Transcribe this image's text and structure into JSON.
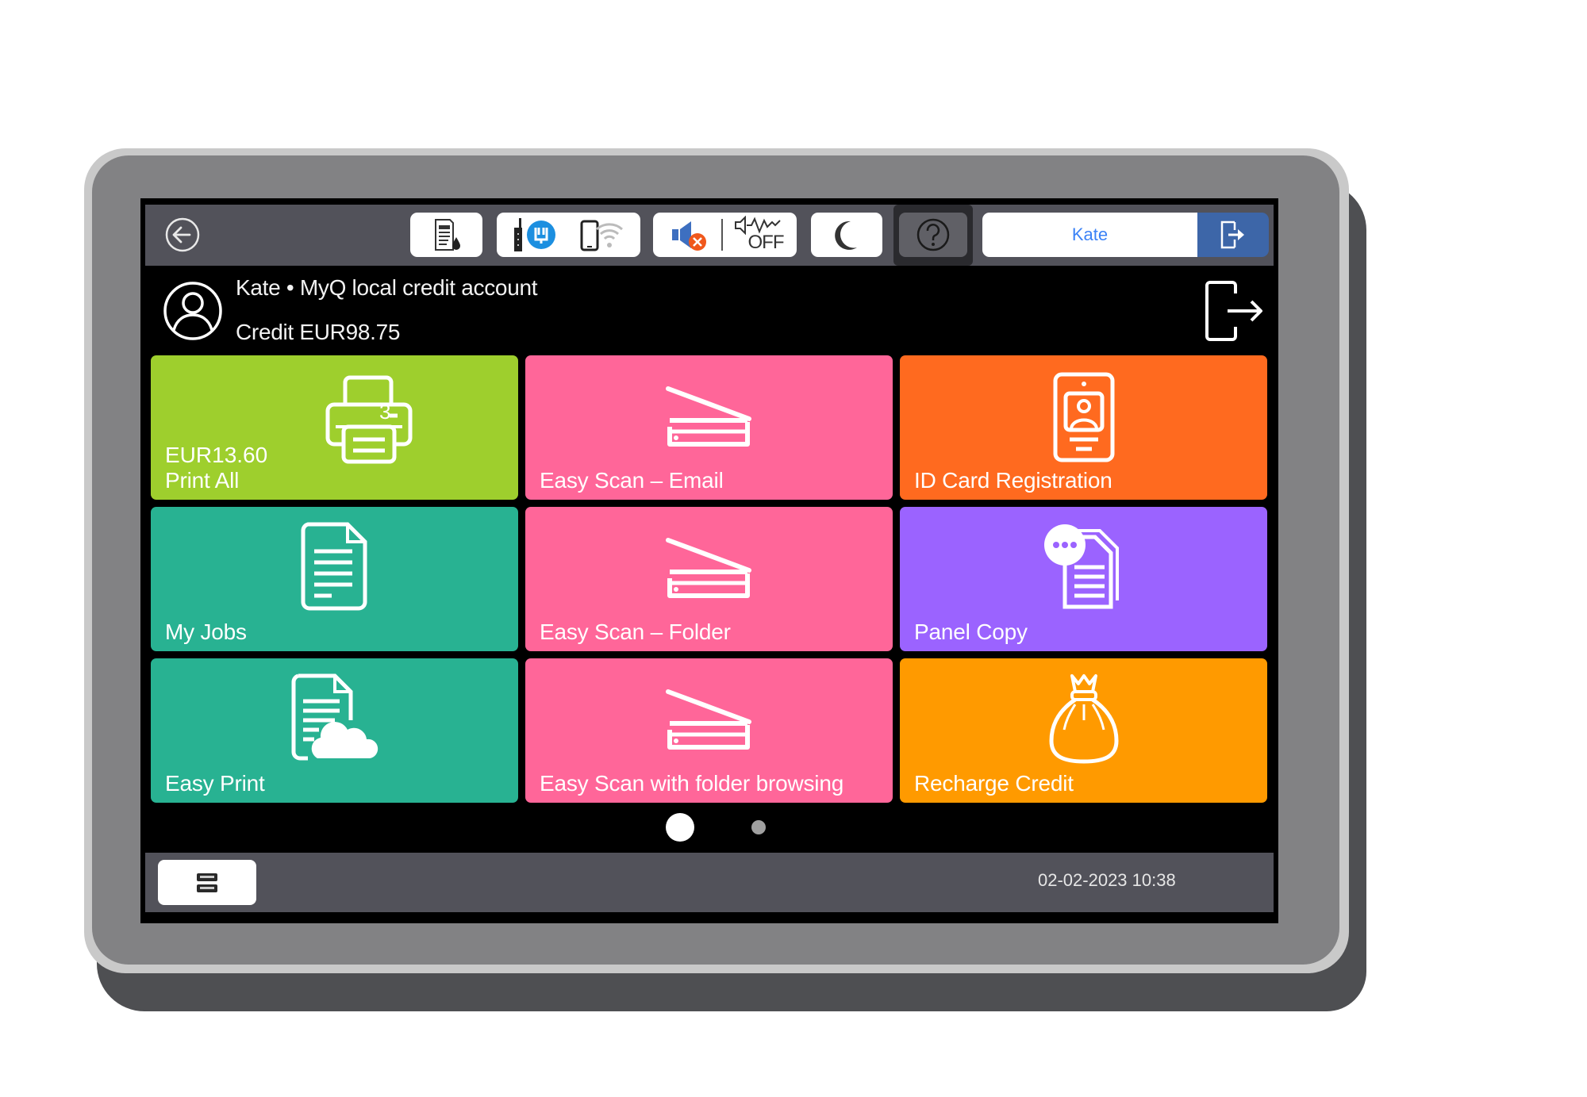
{
  "topbar": {
    "back_icon": "arrow-left-circle-icon",
    "status_buttons": [
      {
        "name": "toner-status",
        "icons": [
          "printer-toner-icon"
        ]
      },
      {
        "name": "network-status",
        "icons": [
          "ethernet-icon",
          "wifi-direct-icon"
        ]
      },
      {
        "name": "sound-status",
        "icons": [
          "speaker-muted-icon",
          "alarm-off-icon"
        ],
        "alarm_text": "OFF"
      },
      {
        "name": "sleep",
        "icons": [
          "moon-icon"
        ]
      },
      {
        "name": "help",
        "icons": [
          "question-circle-icon"
        ]
      }
    ],
    "user_name": "Kate",
    "logout_icon": "logout-icon"
  },
  "header": {
    "account_line": "Kate • MyQ local credit account",
    "credit_line": "Credit EUR98.75",
    "avatar_icon": "user-circle-icon",
    "logout_icon": "logout-icon"
  },
  "tiles": [
    {
      "label": "Print All",
      "amount": "EUR13.60",
      "badge": "3",
      "icon": "printer-icon",
      "color": "#9ecf2d"
    },
    {
      "label": "Easy Scan – Email",
      "icon": "scanner-icon",
      "color": "#ff6699"
    },
    {
      "label": "ID Card Registration",
      "icon": "id-card-icon",
      "color": "#ff6a1f"
    },
    {
      "label": "My Jobs",
      "icon": "document-icon",
      "color": "#28b292"
    },
    {
      "label": "Easy Scan – Folder",
      "icon": "scanner-icon",
      "color": "#ff6699"
    },
    {
      "label": "Panel Copy",
      "icon": "copy-document-icon",
      "color": "#9b63ff"
    },
    {
      "label": "Easy Print",
      "icon": "cloud-document-icon",
      "color": "#28b292"
    },
    {
      "label": "Easy Scan with folder browsing",
      "icon": "scanner-icon",
      "color": "#ff6699"
    },
    {
      "label": "Recharge Credit",
      "icon": "money-bag-icon",
      "color": "#ff9a00"
    }
  ],
  "pagination": {
    "current_page": 1,
    "total_pages": 2
  },
  "bottombar": {
    "menu_icon": "device-menu-icon",
    "datetime": "02-02-2023 10:38"
  }
}
